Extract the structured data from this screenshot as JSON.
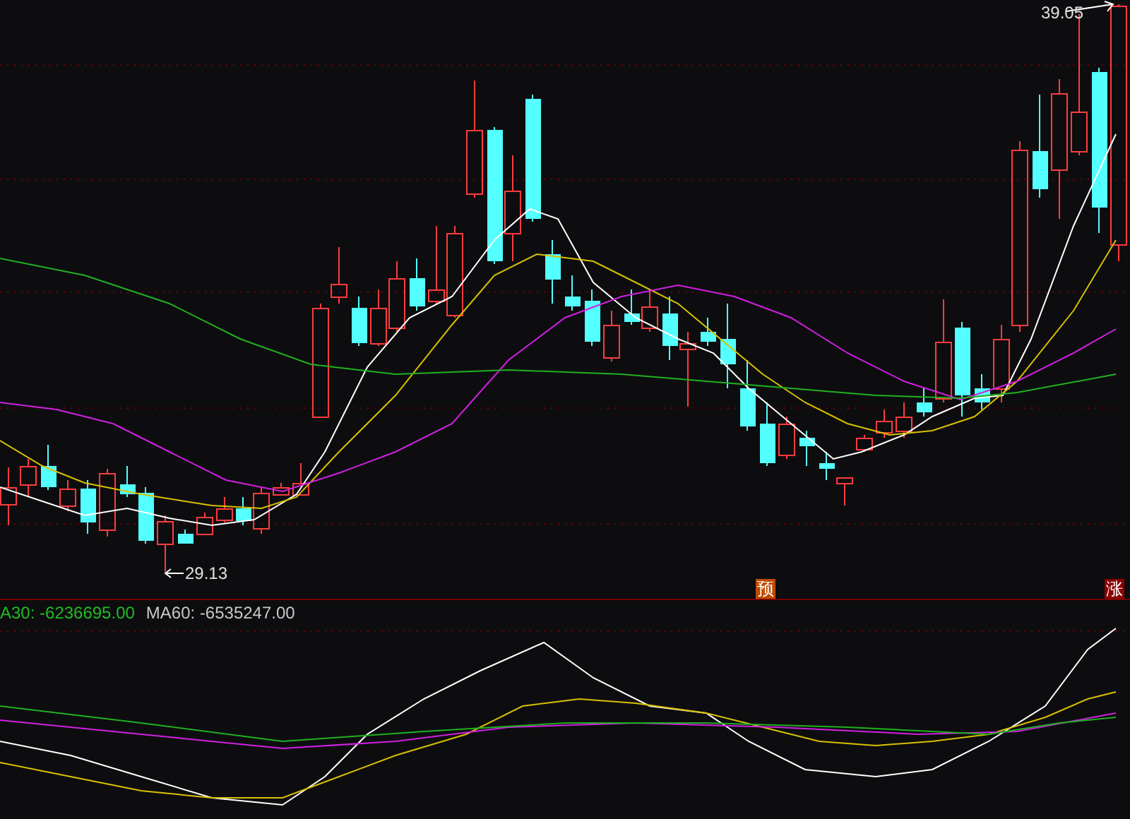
{
  "main_chart": {
    "high_label": "39.05",
    "low_label": "29.13",
    "markers": [
      {
        "text": "预",
        "color": "#c04a00"
      },
      {
        "text": "涨",
        "color": "#8b0000"
      }
    ]
  },
  "indicator": {
    "legends": [
      {
        "text": "A30: -6236695.00",
        "color": "#22bb22"
      },
      {
        "text": "MA60: -6535247.00",
        "color": "#c8c8c8"
      }
    ]
  }
}
